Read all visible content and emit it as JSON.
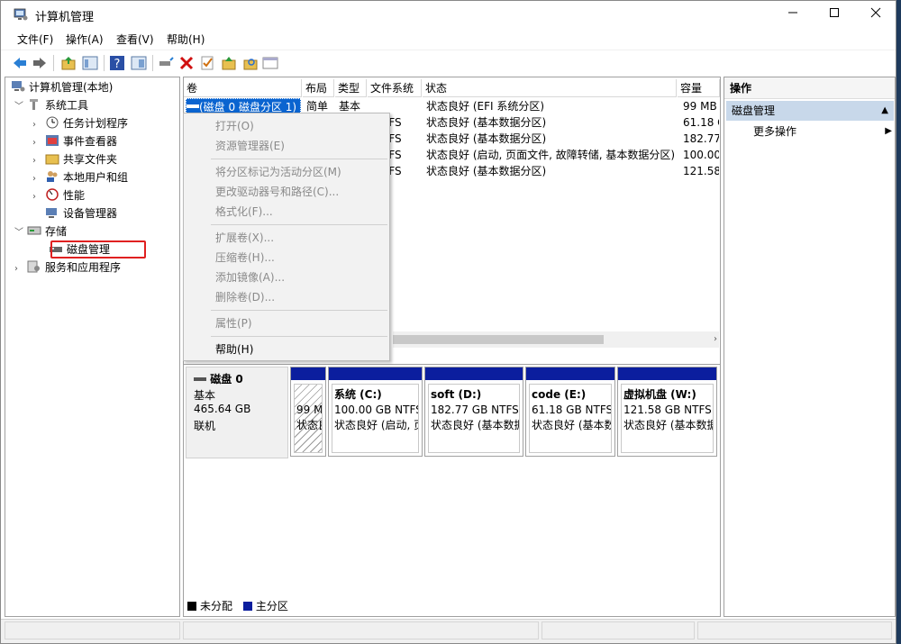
{
  "window": {
    "title": "计算机管理"
  },
  "menu": [
    "文件(F)",
    "操作(A)",
    "查看(V)",
    "帮助(H)"
  ],
  "tree": {
    "root": "计算机管理(本地)",
    "system_tools": "系统工具",
    "task_scheduler": "任务计划程序",
    "event_viewer": "事件查看器",
    "shared_folders": "共享文件夹",
    "local_users": "本地用户和组",
    "performance": "性能",
    "device_manager": "设备管理器",
    "storage": "存储",
    "disk_management": "磁盘管理",
    "services_apps": "服务和应用程序"
  },
  "volume_table": {
    "headers": [
      "卷",
      "布局",
      "类型",
      "文件系统",
      "状态",
      "容量"
    ],
    "rows": [
      {
        "vol": "(磁盘 0 磁盘分区 1)",
        "layout": "简单",
        "type": "基本",
        "fs": "",
        "status": "状态良好 (EFI 系统分区)",
        "capacity": "99 MB"
      },
      {
        "vol": "",
        "layout": "",
        "type": "",
        "fs": "TFS",
        "status": "状态良好 (基本数据分区)",
        "capacity": "61.18 G"
      },
      {
        "vol": "",
        "layout": "",
        "type": "",
        "fs": "TFS",
        "status": "状态良好 (基本数据分区)",
        "capacity": "182.77"
      },
      {
        "vol": "",
        "layout": "",
        "type": "",
        "fs": "TFS",
        "status": "状态良好 (启动, 页面文件, 故障转储, 基本数据分区)",
        "capacity": "100.00"
      },
      {
        "vol": "",
        "layout": "",
        "type": "",
        "fs": "TFS",
        "status": "状态良好 (基本数据分区)",
        "capacity": "121.58"
      }
    ]
  },
  "context_menu": {
    "open": "打开(O)",
    "explorer": "资源管理器(E)",
    "mark_active": "将分区标记为活动分区(M)",
    "change_letter": "更改驱动器号和路径(C)...",
    "format": "格式化(F)...",
    "extend": "扩展卷(X)...",
    "shrink": "压缩卷(H)...",
    "add_mirror": "添加镜像(A)...",
    "delete": "删除卷(D)...",
    "properties": "属性(P)",
    "help": "帮助(H)"
  },
  "disk0": {
    "name": "磁盘 0",
    "kind": "基本",
    "size": "465.64 GB",
    "state": "联机",
    "partitions": [
      {
        "title": "",
        "size": "99 M",
        "status": "状态良"
      },
      {
        "title": "系统  (C:)",
        "size": "100.00 GB NTFS",
        "status": "状态良好 (启动, 页"
      },
      {
        "title": "soft  (D:)",
        "size": "182.77 GB NTFS",
        "status": "状态良好 (基本数据"
      },
      {
        "title": "code  (E:)",
        "size": "61.18 GB NTFS",
        "status": "状态良好 (基本数"
      },
      {
        "title": "虚拟机盘  (W:)",
        "size": "121.58 GB NTFS",
        "status": "状态良好 (基本数据"
      }
    ]
  },
  "legend": {
    "unallocated": "未分配",
    "primary": "主分区",
    "unallocated_color": "#000000",
    "primary_color": "#0b1e9e"
  },
  "actions": {
    "header": "操作",
    "section": "磁盘管理",
    "more": "更多操作"
  },
  "colors": {
    "selection": "#0a64d0",
    "partition_bar": "#0b1e9e",
    "highlight_box": "#e02020"
  }
}
